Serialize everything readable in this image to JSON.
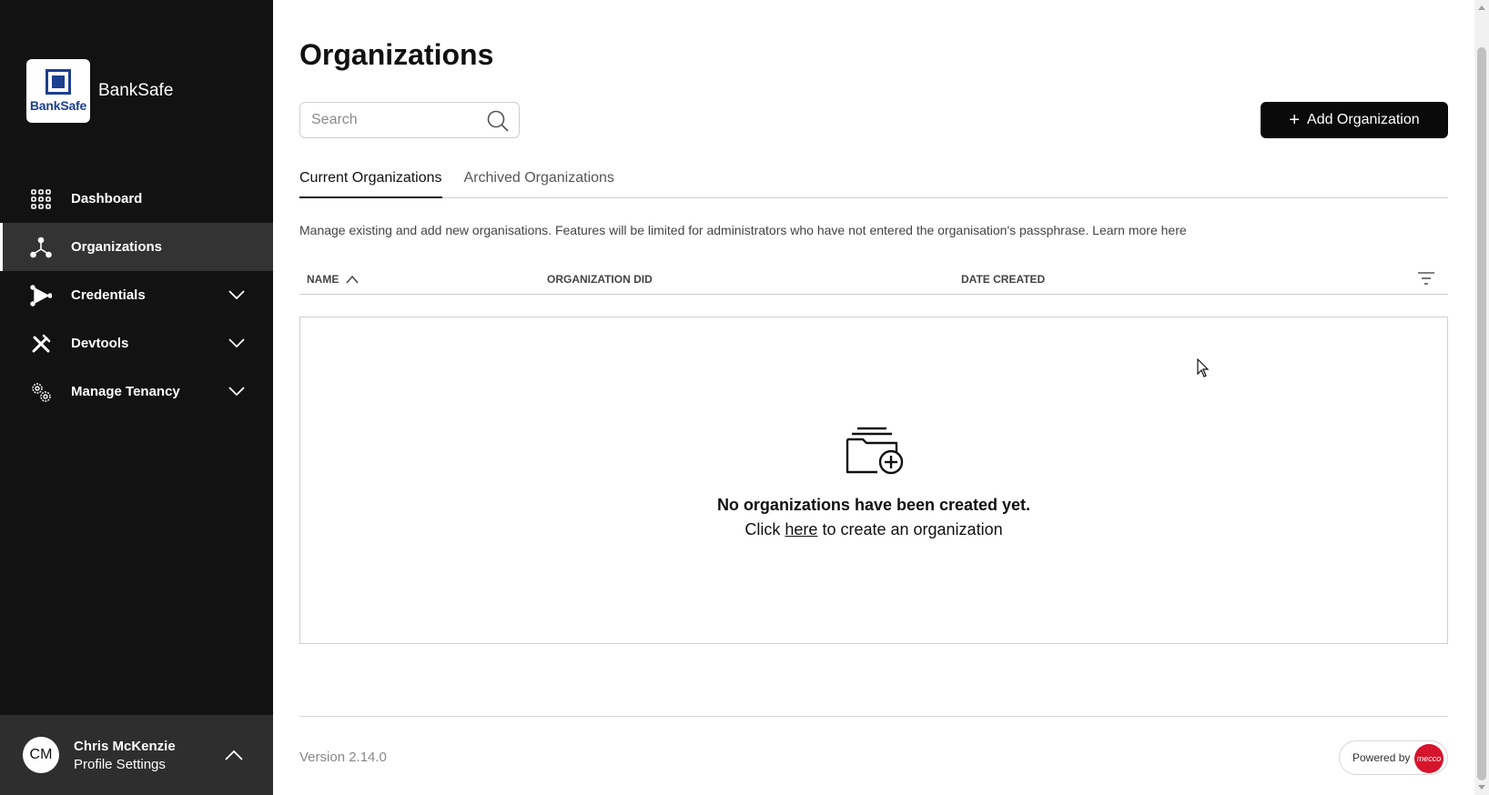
{
  "sidebar": {
    "brand": {
      "logo_text": "BankSafe",
      "name": "BankSafe"
    },
    "items": [
      {
        "label": "Dashboard",
        "icon": "grid-icon",
        "active": false,
        "expandable": false
      },
      {
        "label": "Organizations",
        "icon": "org-tree-icon",
        "active": true,
        "expandable": false
      },
      {
        "label": "Credentials",
        "icon": "credentials-icon",
        "active": false,
        "expandable": true
      },
      {
        "label": "Devtools",
        "icon": "tools-icon",
        "active": false,
        "expandable": true
      },
      {
        "label": "Manage Tenancy",
        "icon": "gears-icon",
        "active": false,
        "expandable": true
      }
    ],
    "profile": {
      "initials": "CM",
      "name": "Chris McKenzie",
      "link": "Profile Settings"
    }
  },
  "main": {
    "title": "Organizations",
    "search": {
      "placeholder": "Search",
      "value": ""
    },
    "add_button": {
      "label": "Add Organization"
    },
    "tabs": [
      {
        "label": "Current Organizations",
        "active": true
      },
      {
        "label": "Archived Organizations",
        "active": false
      }
    ],
    "description": "Manage existing and add new organisations. Features will be limited for administrators who have not entered the organisation's passphrase. Learn more here",
    "table": {
      "columns": [
        {
          "label": "NAME",
          "sort": "asc"
        },
        {
          "label": "ORGANIZATION DID"
        },
        {
          "label": "DATE CREATED"
        }
      ]
    },
    "empty_state": {
      "title": "No organizations have been created yet.",
      "sub_before": "Click",
      "sub_link": "here",
      "sub_after": "to create an organization"
    }
  },
  "footer": {
    "version": "Version 2.14.0",
    "powered_by": "Powered by",
    "powered_logo": "mecco"
  },
  "colors": {
    "sidebar_bg": "#121212",
    "sidebar_active": "#333333",
    "brand_blue": "#1c3f8f",
    "primary_button": "#0a0a0a",
    "powered_red": "#d6142b"
  }
}
